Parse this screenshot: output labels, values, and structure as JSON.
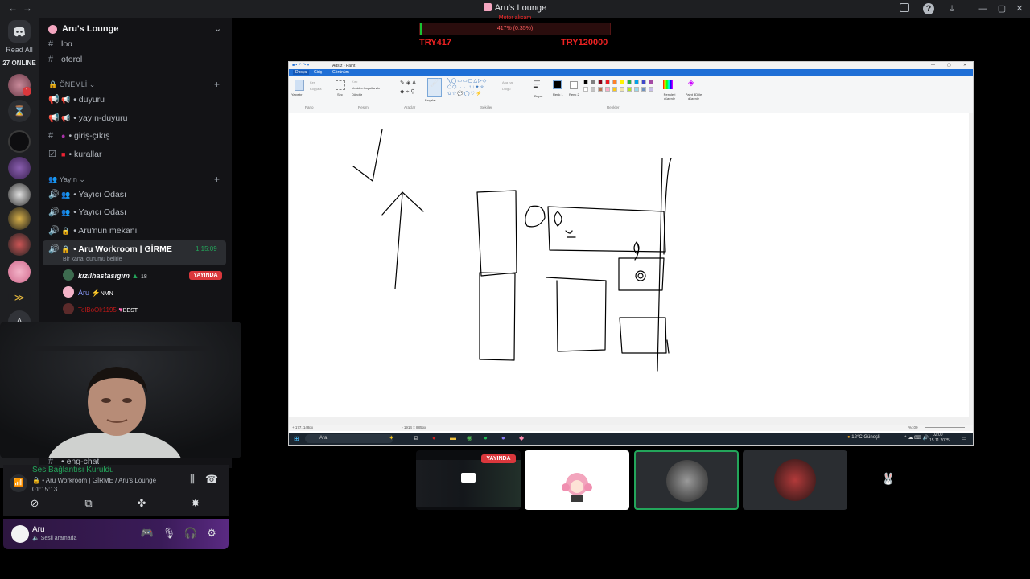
{
  "window": {
    "title": "Aru's Lounge"
  },
  "server_rail": {
    "read_all": "Read All",
    "online": "27 ONLINE",
    "badge": "1",
    "letter_avatar": "A"
  },
  "server": {
    "name": "Aru's Lounge"
  },
  "channels": {
    "partial_top": "log",
    "otorol": "otorol",
    "category_important": "ÖNEMLİ",
    "important": [
      {
        "label": "• duyuru"
      },
      {
        "label": "• yayın-duyuru"
      },
      {
        "label": "• giriş-çıkış"
      },
      {
        "label": "• kurallar"
      }
    ],
    "category_stream": "Yayın",
    "stream": [
      {
        "label": "• Yayıcı Odası"
      },
      {
        "label": "• Yayıcı Odası"
      },
      {
        "label": "• Aru'nun mekanı"
      }
    ],
    "active": {
      "label": "• Aru Workroom | GİRME",
      "timer": "1:15:09",
      "status": "Bir kanal durumu belirle"
    },
    "voice_users": [
      {
        "name": "kızılhastasıgım",
        "extra": "18",
        "live": "YAYINDA"
      },
      {
        "name": "Aru",
        "extra": "NMN"
      },
      {
        "name": "TolBoOlr1195",
        "extra": "BEST"
      }
    ],
    "partial_bottom": "• eng-chat"
  },
  "voice_panel": {
    "status": "Ses Bağlantısı Kuruldu",
    "location": "• Aru Workroom | GİRME / Aru's Lounge",
    "time": "01:15:13"
  },
  "user_panel": {
    "name": "Aru",
    "status": "Sesli aramada"
  },
  "donation": {
    "title": "Motor alıcam",
    "percent_text": "417% (0.35%)",
    "progress": 0.0035,
    "current": "TRY417",
    "goal": "TRY120000"
  },
  "paint": {
    "title": "Adsız - Paint",
    "tabs": [
      "Dosya",
      "Giriş",
      "Görünüm"
    ],
    "groups": [
      "Pano",
      "Resim",
      "Araçlar",
      "Fırçalar",
      "Şekiller",
      "Renkler"
    ],
    "tools": {
      "paste": "Yapıştır",
      "cut": "Kes",
      "copy": "Kopyala",
      "select": "Seç",
      "crop": "Kırp",
      "resize": "Yeniden boyutlandır",
      "rotate": "Döndür",
      "outline": "Ana hat",
      "fill": "Dolgu",
      "size": "Boyut",
      "color1": "Renk 1",
      "color2": "Renk 2",
      "edit_colors": "Renkleri düzenle",
      "paint3d": "Paint 3D ile düzenle"
    },
    "colors": [
      "#000000",
      "#7f7f7f",
      "#880015",
      "#ed1c24",
      "#ff7f27",
      "#fff200",
      "#22b14c",
      "#00a2e8",
      "#3f48cc",
      "#a349a4",
      "#ffffff",
      "#c3c3c3",
      "#b97a57",
      "#ffaec9",
      "#ffc90e",
      "#efe4b0",
      "#b5e61d",
      "#99d9ea",
      "#7092be",
      "#c8bfe7"
    ],
    "status_left": "177, 148px",
    "status_mid": "1914 × 885px",
    "zoom": "%100"
  },
  "taskbar": {
    "search": "Ara",
    "weather": "12°C Güneşli",
    "time": "02:00",
    "date": "15.11.2025"
  },
  "tiles": {
    "live": "YAYINDA"
  }
}
